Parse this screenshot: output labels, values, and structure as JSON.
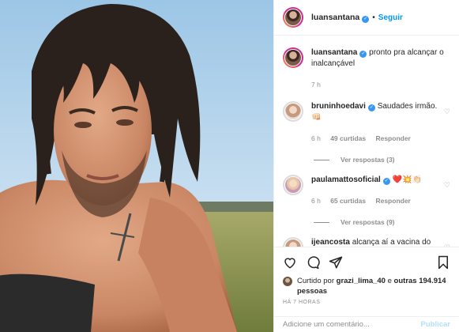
{
  "header": {
    "username": "luansantana",
    "separator": "•",
    "follow_label": "Seguir"
  },
  "caption": {
    "username": "luansantana",
    "text": "pronto pra alcançar o inalcançável",
    "time": "7 h"
  },
  "comments": [
    {
      "username": "bruninhoedavi",
      "text": "Saudades irmão. 👊🏻",
      "time": "6 h",
      "likes": "49 curtidas",
      "reply": "Responder",
      "view_replies": "Ver respostas (3)"
    },
    {
      "username": "paulamattosoficial",
      "text": "❤️💥👏🏻",
      "time": "6 h",
      "likes": "65 curtidas",
      "reply": "Responder",
      "view_replies": "Ver respostas (9)"
    },
    {
      "username": "ijeancosta",
      "text": "alcança aí a vacina do"
    }
  ],
  "likes": {
    "prefix": "Curtido por",
    "user": "grazi_lima_40",
    "mid": "e",
    "others": "outras 194.914 pessoas"
  },
  "timestamp": "HÁ 7 HORAS",
  "add_comment": {
    "placeholder": "Adicione um comentário...",
    "publish": "Publicar"
  },
  "icons": [
    "heart-icon",
    "comment-icon",
    "share-icon",
    "bookmark-icon"
  ],
  "colors": {
    "link": "#0095f6",
    "verified": "#3897f0",
    "muted": "#8e8e8e"
  }
}
